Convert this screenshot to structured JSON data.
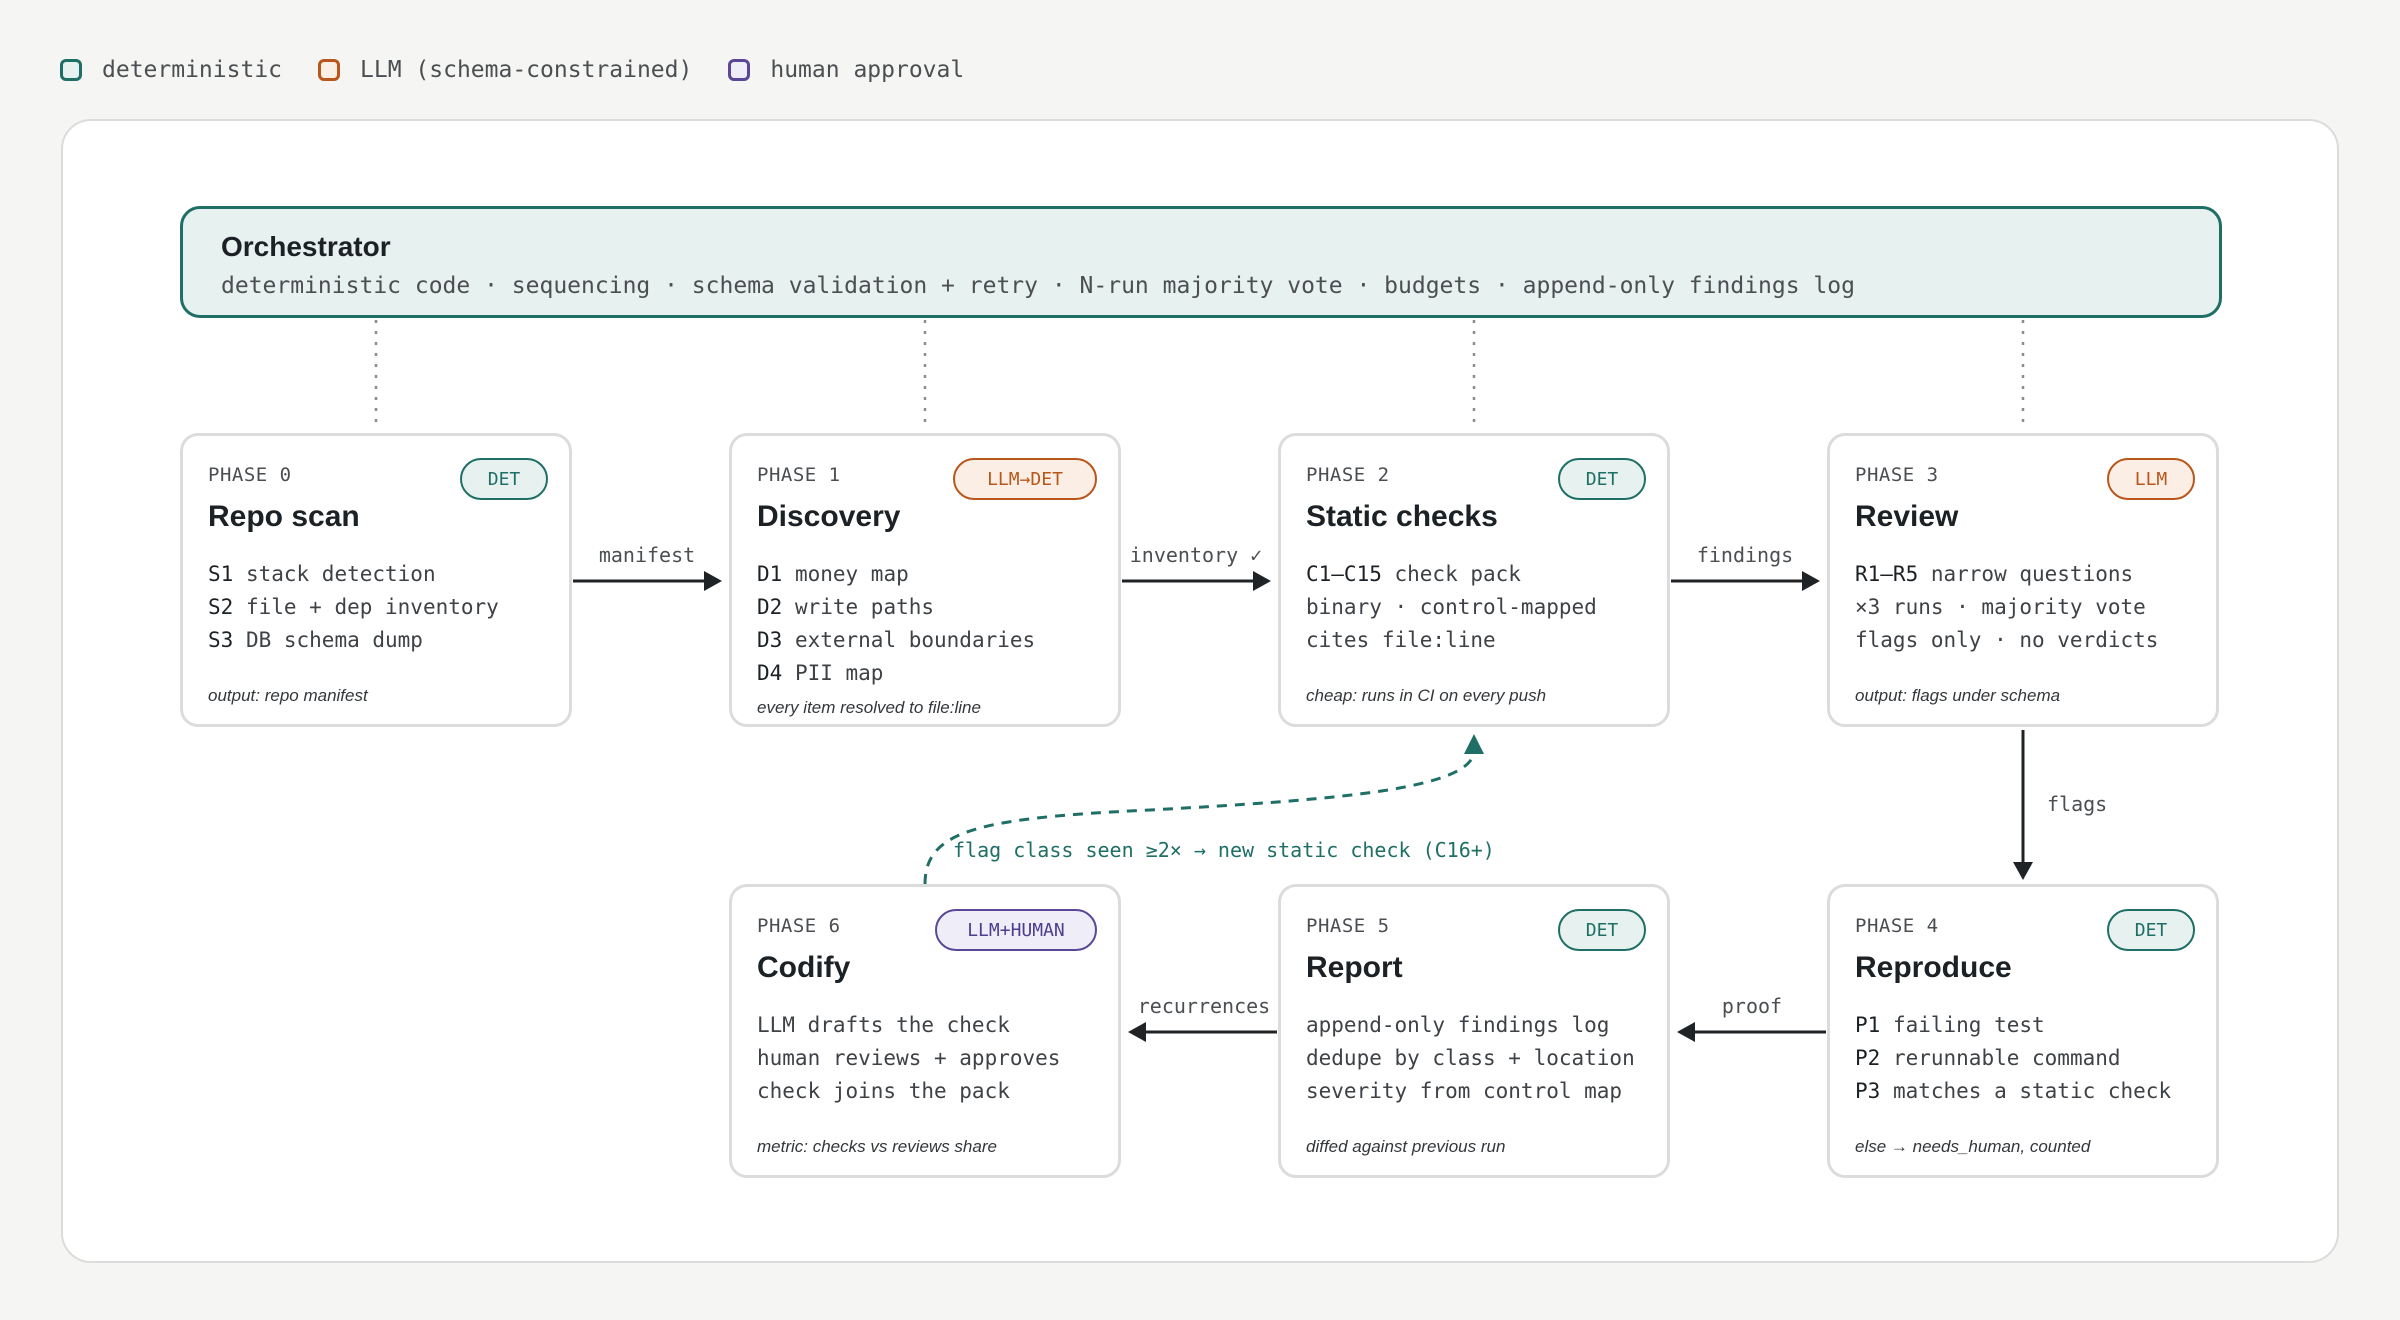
{
  "legend": [
    {
      "label": "deterministic",
      "border": "#1f6f66",
      "fill": "#e7f1ef"
    },
    {
      "label": "LLM (schema-constrained)",
      "border": "#b8561b",
      "fill": "#fbeee4"
    },
    {
      "label": "human approval",
      "border": "#5a4796",
      "fill": "#efedf7"
    }
  ],
  "orchestrator": {
    "title": "Orchestrator",
    "subtitle": "deterministic code · sequencing · schema validation + retry · N-run majority vote · budgets · append-only findings log"
  },
  "phases": [
    {
      "phase": "PHASE 0",
      "title": "Repo scan",
      "badge": "DET",
      "lines": [
        {
          "code": "S1",
          "text": " stack detection"
        },
        {
          "code": "S2",
          "text": " file + dep inventory"
        },
        {
          "code": "S3",
          "text": " DB schema dump"
        }
      ],
      "note": "output: repo manifest"
    },
    {
      "phase": "PHASE 1",
      "title": "Discovery",
      "badge": "LLM→DET",
      "lines": [
        {
          "code": "D1",
          "text": " money map"
        },
        {
          "code": "D2",
          "text": " write paths"
        },
        {
          "code": "D3",
          "text": " external boundaries"
        },
        {
          "code": "D4",
          "text": " PII map"
        }
      ],
      "note": "every item resolved to file:line"
    },
    {
      "phase": "PHASE 2",
      "title": "Static checks",
      "badge": "DET",
      "lines": [
        {
          "code": "C1–C15",
          "text": " check pack"
        },
        {
          "code": "",
          "text": "binary · control-mapped"
        },
        {
          "code": "",
          "text": "cites file:line"
        }
      ],
      "note": "cheap: runs in CI on every push"
    },
    {
      "phase": "PHASE 3",
      "title": "Review",
      "badge": "LLM",
      "lines": [
        {
          "code": "R1–R5",
          "text": " narrow questions"
        },
        {
          "code": "",
          "text": "×3 runs · majority vote"
        },
        {
          "code": "",
          "text": "flags only · no verdicts"
        }
      ],
      "note": "output: flags under schema"
    },
    {
      "phase": "PHASE 4",
      "title": "Reproduce",
      "badge": "DET",
      "lines": [
        {
          "code": "P1",
          "text": " failing test"
        },
        {
          "code": "P2",
          "text": " rerunnable command"
        },
        {
          "code": "P3",
          "text": " matches a static check"
        }
      ],
      "note": "else → needs_human, counted"
    },
    {
      "phase": "PHASE 5",
      "title": "Report",
      "badge": "DET",
      "lines": [
        {
          "code": "",
          "text": "append-only findings log"
        },
        {
          "code": "",
          "text": "dedupe by class + location"
        },
        {
          "code": "",
          "text": "severity from control map"
        }
      ],
      "note": "diffed against previous run"
    },
    {
      "phase": "PHASE 6",
      "title": "Codify",
      "badge": "LLM+HUMAN",
      "lines": [
        {
          "code": "",
          "text": "LLM drafts the check"
        },
        {
          "code": "",
          "text": "human reviews + approves"
        },
        {
          "code": "",
          "text": "check joins the pack"
        }
      ],
      "note": "metric: checks vs reviews share"
    }
  ],
  "edges": {
    "e01": "manifest",
    "e12": "inventory ✓",
    "e23": "findings",
    "e34": "flags",
    "e45": "proof",
    "e56": "recurrences",
    "loop": "flag class seen ≥2× → new static check (C16+)"
  }
}
